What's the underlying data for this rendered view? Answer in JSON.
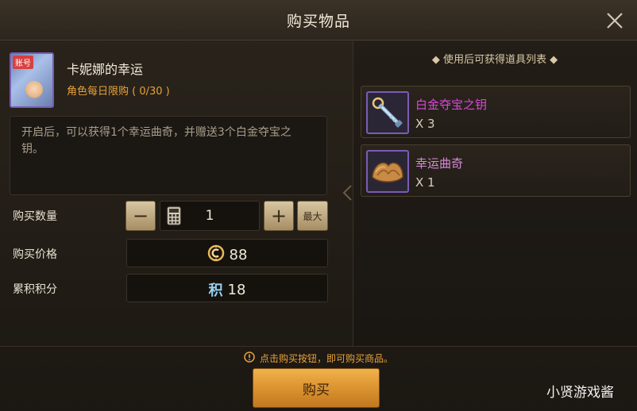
{
  "dialog": {
    "title": "购买物品"
  },
  "item": {
    "tag": "账号",
    "name": "卡妮娜的幸运",
    "limit": "角色每日限购 ( 0/30 )",
    "description": "开启后，可以获得1个幸运曲奇，并赠送3个白金夺宝之钥。",
    "border_color": "#7a5cb3"
  },
  "purchase": {
    "quantity_label": "购买数量",
    "quantity": "1",
    "minus_label": "−",
    "plus_label": "+",
    "max_label": "最大",
    "price_label": "购买价格",
    "price": "88",
    "points_label": "累积积分",
    "points_icon": "积",
    "points": "18"
  },
  "rewards": {
    "header": "◆ 使用后可获得道具列表 ◆",
    "items": [
      {
        "name": "白金夺宝之钥",
        "qty": "X 3",
        "icon": "platinum-key-icon"
      },
      {
        "name": "幸运曲奇",
        "qty": "X 1",
        "icon": "fortune-cookie-icon"
      }
    ]
  },
  "footer": {
    "hint": "点击购买按钮，即可购买商品。",
    "buy_label": "购买",
    "watermark": "小贤游戏酱"
  },
  "colors": {
    "accent": "#e8a23a",
    "rare_name": "#d948d9",
    "buy_button": "#e7a03c"
  }
}
